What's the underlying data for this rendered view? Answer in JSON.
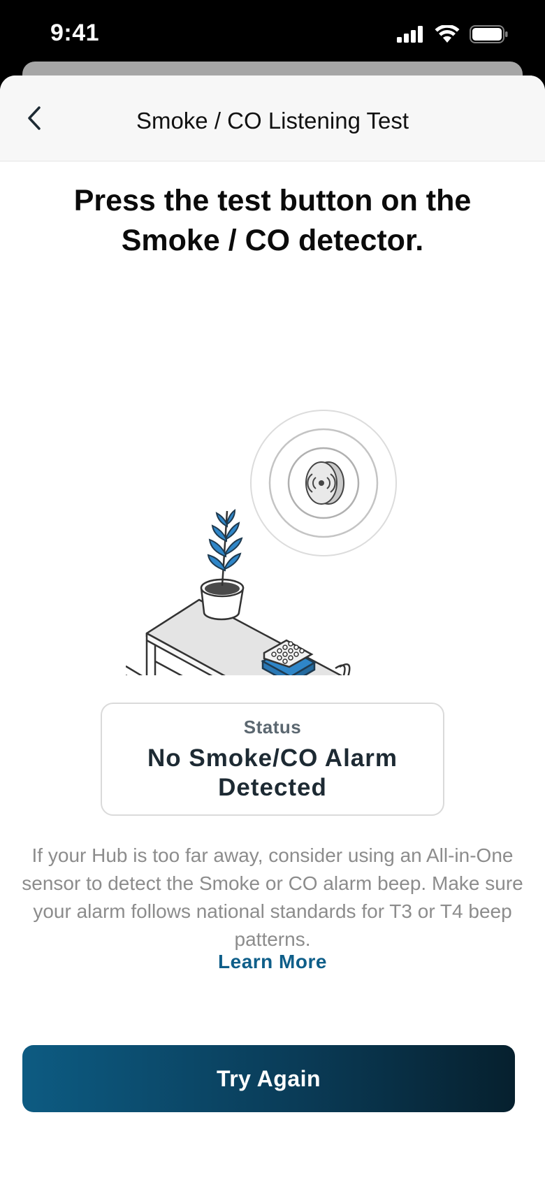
{
  "status_bar": {
    "time": "9:41"
  },
  "nav": {
    "title": "Smoke / CO Listening Test"
  },
  "headline": "Press the test button on the Smoke / CO detector.",
  "status_card": {
    "label": "Status",
    "value": "No Smoke/CO Alarm Detected"
  },
  "info": {
    "text": "If your Hub is too far away, consider using an All-in-One sensor to detect the Smoke or CO alarm beep. Make sure your alarm follows national standards for T3 or T4 beep patterns.",
    "link": "Learn More"
  },
  "actions": {
    "primary": "Try Again"
  },
  "colors": {
    "accent": "#0e5e89",
    "button_gradient": [
      "#0d5b82",
      "#06202e"
    ],
    "illustration_blue": "#2f86c8"
  }
}
